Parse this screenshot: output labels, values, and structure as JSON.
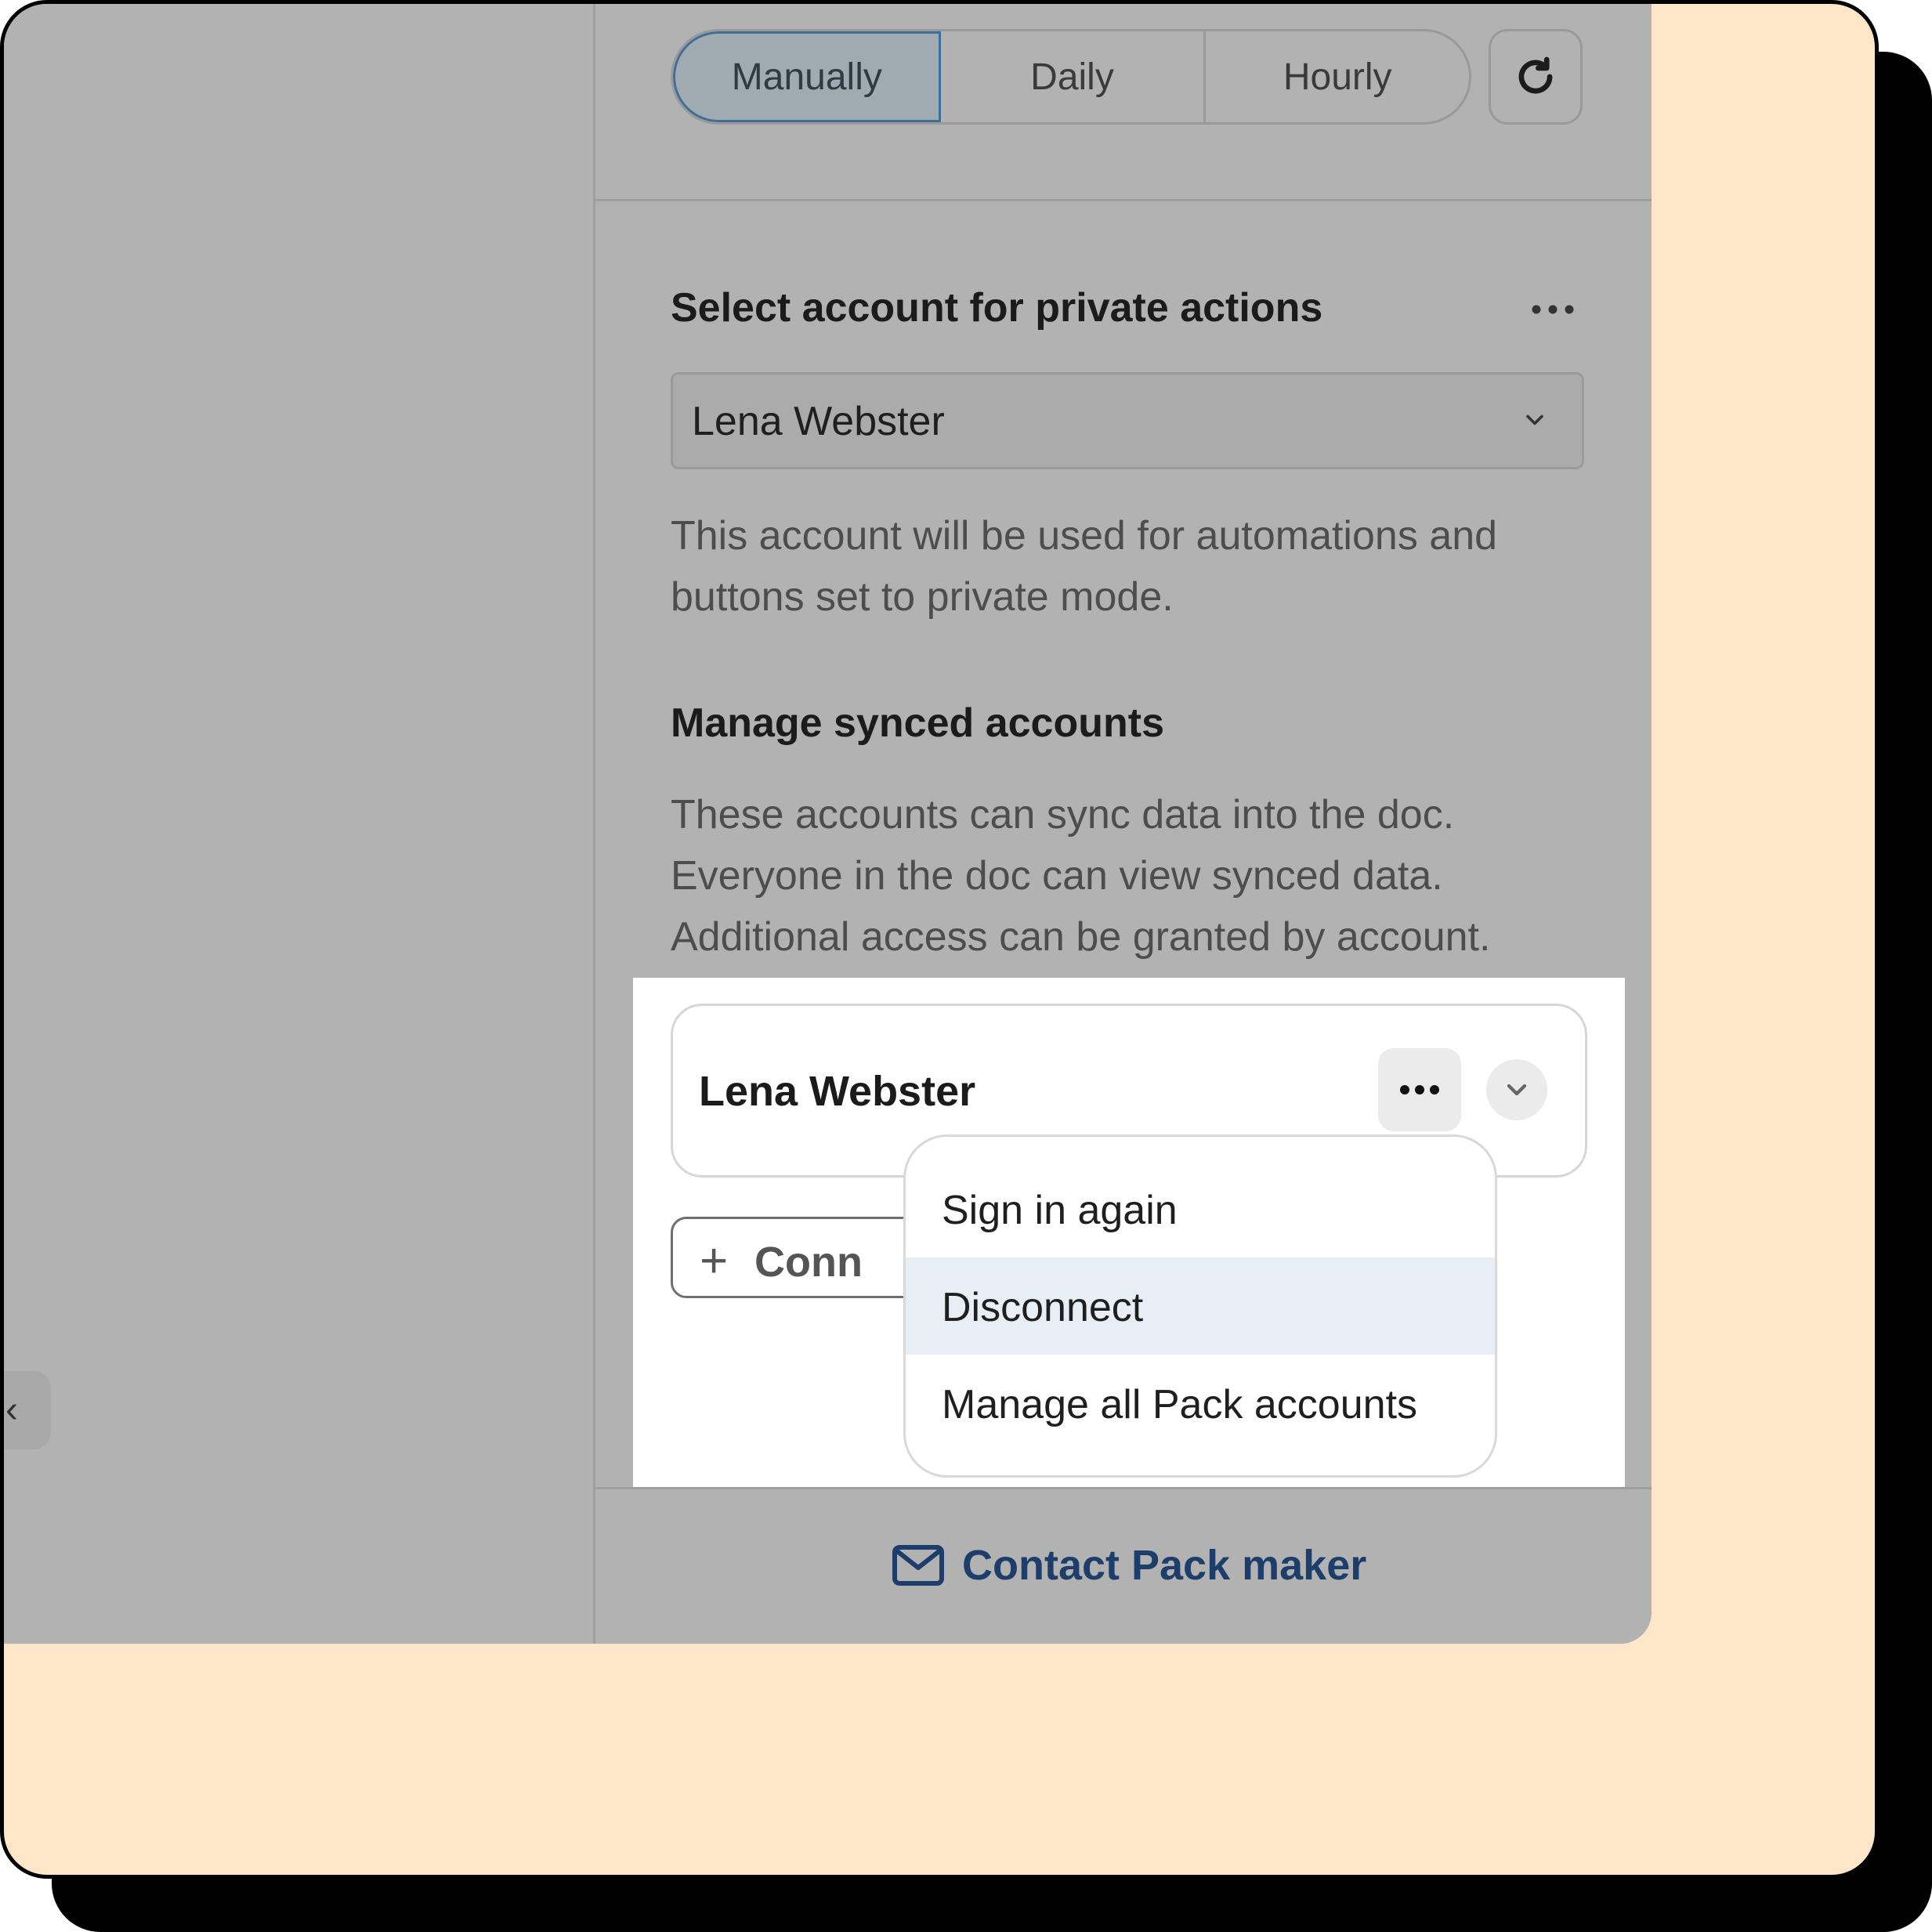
{
  "refresh_frequency": {
    "options": [
      "Manually",
      "Daily",
      "Hourly"
    ],
    "selected": "Manually"
  },
  "private_actions": {
    "title": "Select account for private actions",
    "selected_account": "Lena Webster",
    "description": "This account will be used for automations and buttons set to private mode."
  },
  "synced_accounts": {
    "title": "Manage synced accounts",
    "description": "These accounts can sync data into the doc. Everyone in the doc can view synced data. Additional access can be granted by account.",
    "account": "Lena Webster",
    "connect_label": "Conn"
  },
  "account_menu": {
    "items": [
      "Sign in again",
      "Disconnect",
      "Manage all Pack accounts"
    ],
    "highlighted": "Disconnect"
  },
  "footer": {
    "contact_label": "Contact Pack maker"
  },
  "icons": {
    "refresh": "refresh-icon",
    "more": "more-horizontal-icon",
    "chevron": "chevron-down-icon",
    "plus": "plus-icon",
    "mail": "mail-icon"
  },
  "colors": {
    "backdrop": "#ffe6c8",
    "overlay_gray": "#b2b2b2",
    "selected_border": "#3f6e98",
    "menu_highlight": "#e8eef5",
    "link": "#1d3e6b"
  }
}
